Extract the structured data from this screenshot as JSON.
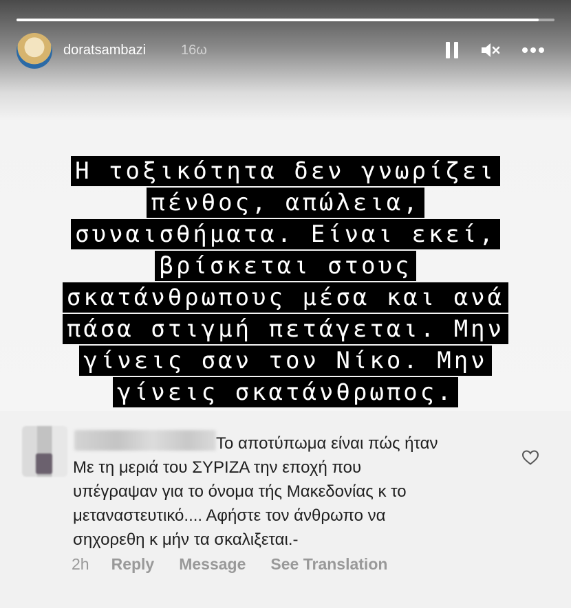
{
  "story": {
    "progress": 0.97,
    "username": "doratsambazi",
    "timestamp": "16ω",
    "text_lines": [
      "Η τοξικότητα δεν γνωρίζει",
      "πένθος, απώλεια,",
      "συναισθήματα. Είναι εκεί,",
      "βρίσκεται στους",
      "σκατάνθρωπους μέσα και ανά",
      "πάσα στιγμή πετάγεται. Μην",
      "γίνεις σαν τον Νίκο. Μην",
      "γίνεις σκατάνθρωπος."
    ],
    "icons": {
      "pause": "pause-icon",
      "mute": "volume-muted-icon",
      "more": "more-horizontal-icon"
    }
  },
  "comment": {
    "lines": [
      "Το αποτύπωμα είναι πώς ήταν",
      "Με τη μεριά του ΣΥΡΙΖΑ την εποχή που",
      "υπέγραψαν για το όνομα τής Μακεδονίας κ το",
      "μεταναστευτικό.... Αφήστε τον άνθρωπο να",
      "σηχορεθη κ μήν τα σκαλιξεται.-"
    ],
    "time": "2h",
    "reply_label": "Reply",
    "message_label": "Message",
    "translation_label": "See Translation",
    "like_icon": "heart-outline-icon"
  }
}
